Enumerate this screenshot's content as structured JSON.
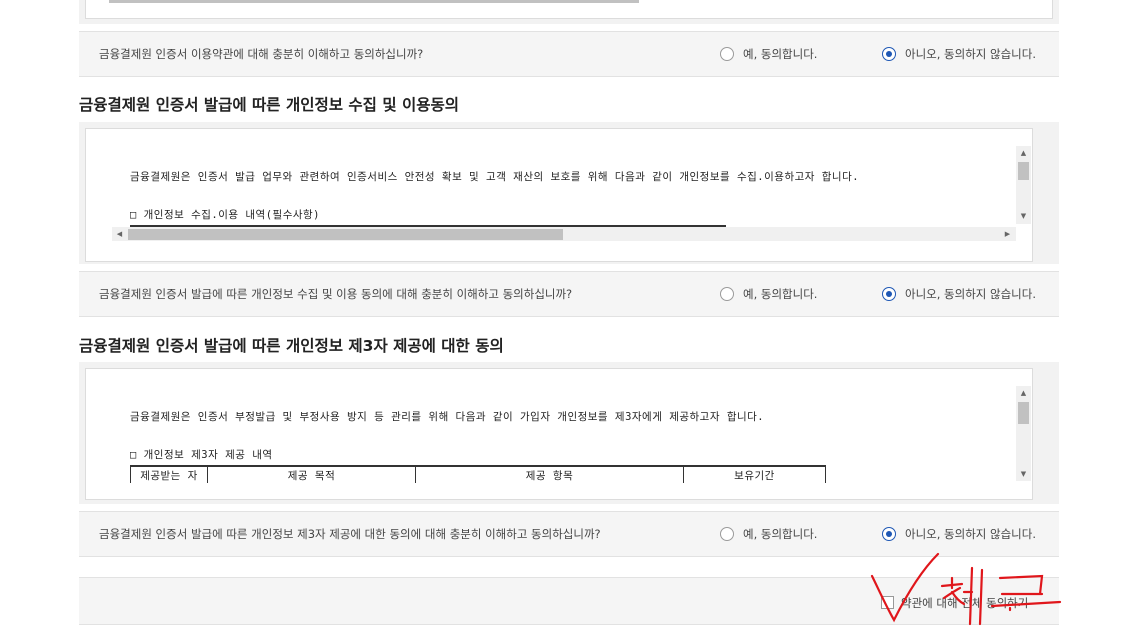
{
  "section1": {
    "question": "금융결제원 인증서 이용약관에 대해 충분히 이해하고 동의하십니까?",
    "yes_label": "예, 동의합니다.",
    "no_label": "아니오, 동의하지 않습니다.",
    "selected": "no"
  },
  "section2": {
    "heading": "금융결제원 인증서 발급에 따른 개인정보 수집 및 이용동의",
    "doc_line1": "금융결제원은 인증서 발급 업무와 관련하여 인증서비스 안전성 확보 및 고객 재산의 보호를 위해 다음과 같이 개인정보를 수집.이용하고자 합니다.",
    "doc_line2": "□ 개인정보 수집.이용 내역(필수사항)",
    "question": "금융결제원 인증서 발급에 따른 개인정보 수집 및 이용 동의에 대해 충분히 이해하고 동의하십니까?",
    "yes_label": "예, 동의합니다.",
    "no_label": "아니오, 동의하지 않습니다.",
    "selected": "no"
  },
  "section3": {
    "heading": "금융결제원 인증서 발급에 따른 개인정보 제3자 제공에 대한 동의",
    "doc_line1": "금융결제원은 인증서 부정발급 및 부정사용 방지 등 관리를 위해 다음과 같이 가입자 개인정보를 제3자에게 제공하고자 합니다.",
    "doc_line2": "□ 개인정보 제3자 제공 내역",
    "table_headers": [
      "제공받는 자",
      "제공 목적",
      "제공 항목",
      "보유기간"
    ],
    "question": "금융결제원 인증서 발급에 따른 개인정보 제3자 제공에 대한 동의에 대해 충분히 이해하고 동의하십니까?",
    "yes_label": "예, 동의합니다.",
    "no_label": "아니오, 동의하지 않습니다.",
    "selected": "no"
  },
  "agree_all": {
    "label": "약관에 대해 전체 동의하기",
    "checked": false
  },
  "annotation": {
    "handwritten_text": "체크",
    "color": "#e0161b"
  }
}
